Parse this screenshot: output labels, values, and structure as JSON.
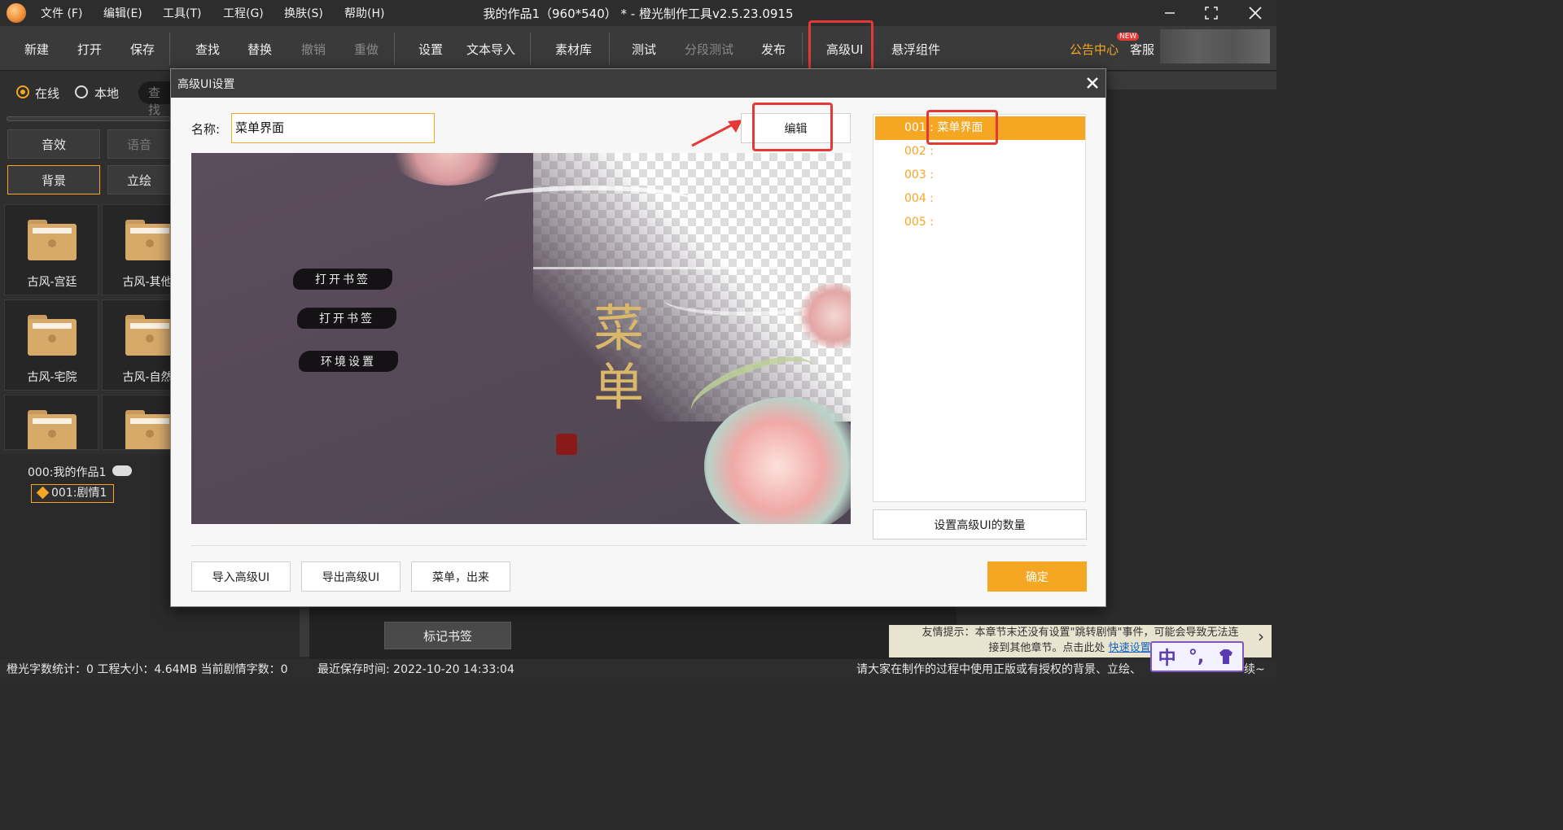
{
  "window": {
    "title": "我的作品1（960*540） * - 橙光制作工具v2.5.23.0915",
    "menus": [
      "文件 (F)",
      "编辑(E)",
      "工具(T)",
      "工程(G)",
      "换肤(S)",
      "帮助(H)"
    ]
  },
  "toolbar": {
    "new": "新建",
    "open": "打开",
    "save": "保存",
    "find": "查找",
    "replace": "替换",
    "undo": "撤销",
    "redo": "重做",
    "settings": "设置",
    "text_import": "文本导入",
    "assets": "素材库",
    "test": "测试",
    "segment_test": "分段测试",
    "publish": "发布",
    "advanced_ui": "高级UI",
    "floating": "悬浮组件",
    "notice": "公告中心",
    "new_badge": "NEW",
    "service": "客服"
  },
  "left": {
    "online": "在线",
    "local": "本地",
    "search_placeholder": "查找",
    "cat_sound": "音效",
    "cat_voice": "语音",
    "cat_bg": "背景",
    "cat_stand": "立绘",
    "folders": [
      "古风-宫廷",
      "古风-其他",
      "古风-宅院",
      "古风-自然"
    ],
    "tree_root": "000:我的作品1",
    "tree_child": "001:剧情1"
  },
  "dialog": {
    "title": "高级UI设置",
    "name_label": "名称:",
    "name_value": "菜单界面",
    "edit_button": "编辑",
    "preview": {
      "btn1": "打开书签",
      "btn2": "打开书签",
      "btn3": "环境设置",
      "title_art": "菜\n单"
    },
    "list": [
      "001 : 菜单界面",
      "002 :",
      "003 :",
      "004 :",
      "005 :"
    ],
    "set_count_button": "设置高级UI的数量",
    "import_button": "导入高级UI",
    "export_button": "导出高级UI",
    "menu_out_button": "菜单，出来",
    "ok_button": "确定"
  },
  "editor": {
    "bookmark_button": "标记书签",
    "hint_line1": "友情提示：本章节末还没有设置\"跳转剧情\"事件，可能会导致无法连",
    "hint_line2": "接到其他章节。点击此处",
    "hint_link": "快速设置跳转"
  },
  "status": {
    "text": "橙光字数统计：0  工程大小：4.64MB  当前剧情字数：0",
    "saved": "最近保存时间:   2022-10-20 14:33:04",
    "right": "请大家在制作的过程中使用正版或有授权的背景、立绘、",
    "right_tail": "续~"
  },
  "ime": {
    "label": "中"
  },
  "colors": {
    "accent": "#f5a623",
    "highlight_box": "#e53935",
    "dialog_bg": "#f7f7f7"
  }
}
